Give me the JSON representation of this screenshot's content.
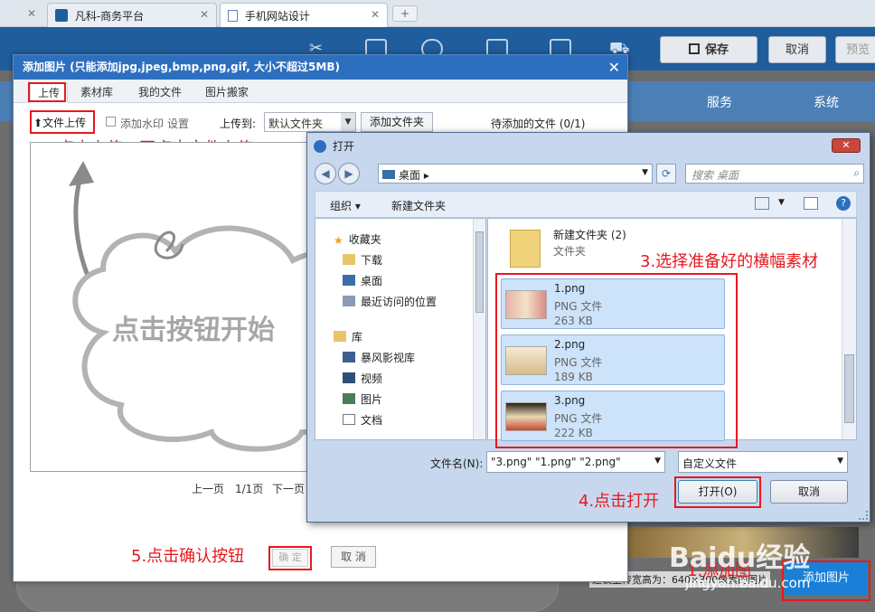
{
  "browser": {
    "tab1_label": "凡科-商务平台",
    "tab2_label": "手机网站设计",
    "close_glyph": "✕",
    "new_tab_glyph": "+"
  },
  "app": {
    "save_label": "保存",
    "cancel_label": "取消",
    "preview_label": "预览",
    "nav_service": "服务",
    "nav_system": "系统"
  },
  "dialog": {
    "title": "添加图片 (只能添加jpg,jpeg,bmp,png,gif, 大小不超过5MB)",
    "close_glyph": "✕",
    "tabs": [
      "上传",
      "素材库",
      "我的文件",
      "图片搬家"
    ],
    "upload_label": "文件上传",
    "watermark_label": "添加水印",
    "settings_label": "设置",
    "upload_to_label": "上传到:",
    "folder_value": "默认文件夹",
    "add_folder_label": "添加文件夹",
    "pending_label": "待添加的文件 (0/1)",
    "drop_text": "点击按钮开始",
    "pager_prev": "上一页",
    "pager_count": "1/1页",
    "pager_next": "下一页",
    "confirm_label": "确 定",
    "cancel_label": "取 消",
    "hint_text": "建议上传宽高为：640×300像素的图片",
    "add_image_label": "添加图片"
  },
  "annotations": {
    "step2": "2.点击上传，再点击文件上传",
    "step3": "3.选择准备好的横幅素材",
    "step4": "4.点击打开",
    "step5": "5.点击确认按钮",
    "step1": "1.添加图"
  },
  "open_dialog": {
    "title": "打开",
    "close_glyph": "✕",
    "address": "桌面",
    "search_placeholder": "搜索 桌面",
    "organize_label": "组织 ▾",
    "new_folder_label": "新建文件夹",
    "tree": [
      "收藏夹",
      "下载",
      "桌面",
      "最近访问的位置",
      "库",
      "暴风影视库",
      "视频",
      "图片",
      "文档"
    ],
    "folder": {
      "name": "新建文件夹 (2)",
      "type": "文件夹"
    },
    "files": [
      {
        "name": "1.png",
        "type": "PNG 文件",
        "size": "263 KB"
      },
      {
        "name": "2.png",
        "type": "PNG 文件",
        "size": "189 KB"
      },
      {
        "name": "3.png",
        "type": "PNG 文件",
        "size": "222 KB"
      }
    ],
    "filename_label": "文件名(N):",
    "filename_value": "\"3.png\" \"1.png\" \"2.png\"",
    "filter_value": "自定义文件",
    "open_label": "打开(O)",
    "cancel_label": "取消"
  },
  "watermark": {
    "brand": "Baidu经验",
    "url": "jingyan.baidu.com"
  },
  "colors": {
    "accent": "#2d6fbf",
    "annotation_red": "#e8181e",
    "appbar": "#1f5d9d"
  }
}
